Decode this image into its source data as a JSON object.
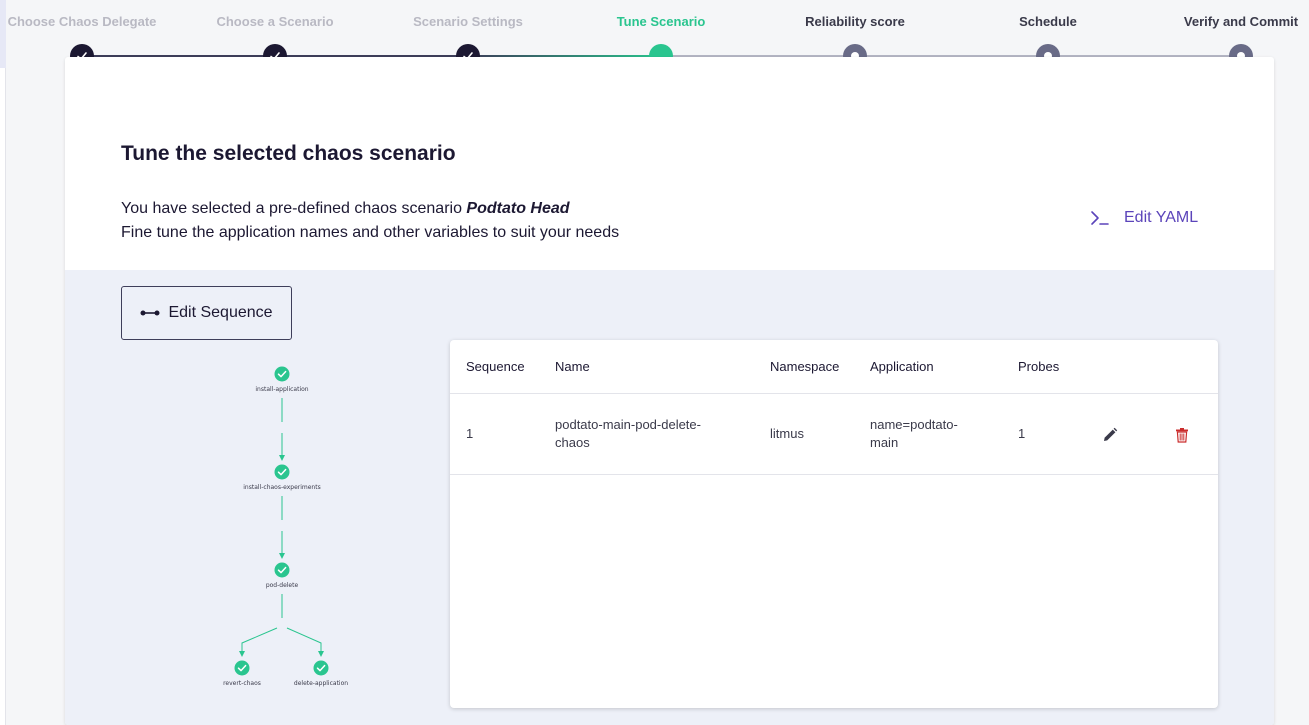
{
  "stepper": {
    "steps": [
      {
        "label": "Choose Chaos Delegate",
        "state": "done"
      },
      {
        "label": "Choose a Scenario",
        "state": "done"
      },
      {
        "label": "Scenario Settings",
        "state": "done"
      },
      {
        "label": "Tune Scenario",
        "state": "active"
      },
      {
        "label": "Reliability score",
        "state": "pending"
      },
      {
        "label": "Schedule",
        "state": "pending"
      },
      {
        "label": "Verify and Commit",
        "state": "pending"
      }
    ]
  },
  "card": {
    "title": "Tune the selected chaos scenario",
    "desc_line1_prefix": "You have selected a pre-defined chaos scenario ",
    "scenario_name": "Podtato Head",
    "desc_line2": "Fine tune the application names and other variables to suit your needs",
    "edit_yaml_label": "Edit YAML",
    "edit_sequence_label": "Edit Sequence"
  },
  "graph": {
    "nodes": [
      "install-application",
      "install-chaos-experiments",
      "pod-delete",
      "revert-chaos",
      "delete-application"
    ]
  },
  "table": {
    "headers": [
      "Sequence",
      "Name",
      "Namespace",
      "Application",
      "Probes"
    ],
    "rows": [
      {
        "sequence": "1",
        "name_line1": "podtato-main-pod-delete-",
        "name_line2": "chaos",
        "namespace": "litmus",
        "app_line1": "name=podtato-",
        "app_line2": "main",
        "probes": "1"
      }
    ]
  },
  "colors": {
    "active": "#2ac58f",
    "done": "#1c1832",
    "pending": "#696b87",
    "accent": "#5b44ba",
    "delete": "#ca2c2c"
  }
}
